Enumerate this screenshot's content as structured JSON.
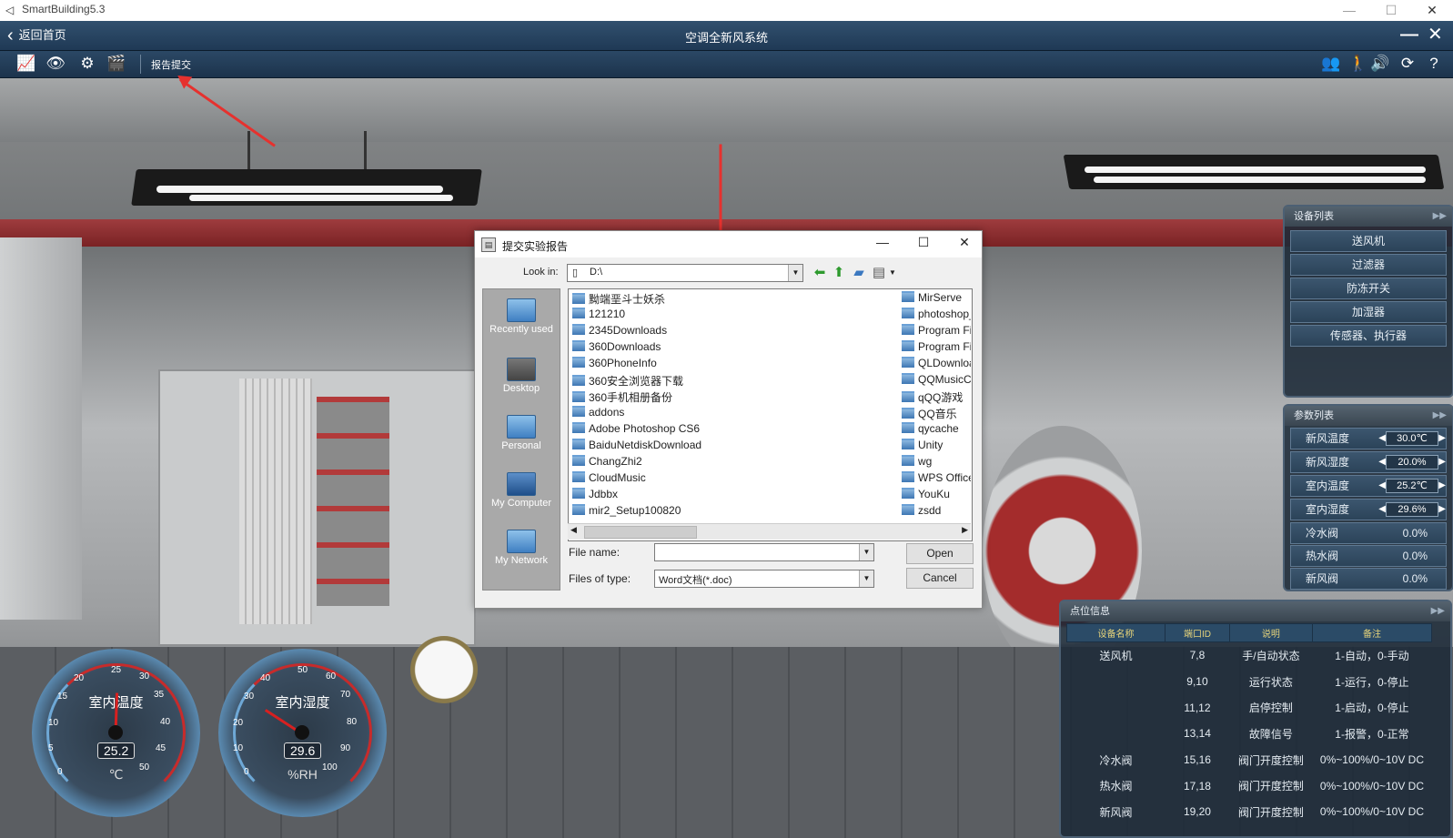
{
  "window": {
    "title": "SmartBuilding5.3",
    "minimize": "—",
    "maximize": "☐",
    "close": "✕"
  },
  "header": {
    "back_label": "返回首页",
    "title": "空调全新风系统",
    "minimize_symbol": "—",
    "close_symbol": "✕"
  },
  "toolbar": {
    "report_label": "报告提交",
    "left_icons": [
      "chart-icon",
      "eye-icon",
      "network-icon",
      "clapper-icon"
    ],
    "right_icons": [
      "users-icon",
      "walk-icon",
      "speaker-icon",
      "refresh-icon",
      "help-icon"
    ]
  },
  "dialog": {
    "title": "提交实验报告",
    "look_in_label": "Look in:",
    "look_in_value": "D:\\",
    "places": [
      {
        "label": "Recently used"
      },
      {
        "label": "Desktop"
      },
      {
        "label": "Personal"
      },
      {
        "label": "My Computer"
      },
      {
        "label": "My Network"
      }
    ],
    "files_col1": [
      "黝端垩斗士妖杀",
      "121210",
      "2345Downloads",
      "360Downloads",
      "360PhoneInfo",
      "360安全浏览器下载",
      "360手机相册备份",
      "addons",
      "Adobe Photoshop CS6",
      "BaiduNetdiskDownload",
      "ChangZhi2",
      "CloudMusic",
      "Jdbbx",
      "mir2_Setup100820"
    ],
    "files_col2": [
      "MirServe",
      "photoshop_c",
      "Program File",
      "Program File",
      "QLDownloa",
      "QQMusicCa",
      "qQQ游戏",
      "QQ音乐",
      "qycache",
      "Unity",
      "wg",
      "WPS Office",
      "YouKu",
      "zsdd"
    ],
    "file_name_label": "File name:",
    "file_name_value": "",
    "file_type_label": "Files of type:",
    "file_type_value": "Word文档(*.doc)",
    "open_label": "Open",
    "cancel_label": "Cancel"
  },
  "device_panel": {
    "title": "设备列表",
    "items": [
      "送风机",
      "过滤器",
      "防冻开关",
      "加湿器",
      "传感器、执行器"
    ]
  },
  "param_panel": {
    "title": "参数列表",
    "rows": [
      {
        "name": "新风温度",
        "value": "30.0℃",
        "adjustable": true
      },
      {
        "name": "新风湿度",
        "value": "20.0%",
        "adjustable": true
      },
      {
        "name": "室内温度",
        "value": "25.2℃",
        "adjustable": true
      },
      {
        "name": "室内湿度",
        "value": "29.6%",
        "adjustable": true
      },
      {
        "name": "冷水阀",
        "value": "0.0%",
        "adjustable": false
      },
      {
        "name": "热水阀",
        "value": "0.0%",
        "adjustable": false
      },
      {
        "name": "新风阀",
        "value": "0.0%",
        "adjustable": false
      }
    ]
  },
  "point_panel": {
    "title": "点位信息",
    "columns": [
      "设备名称",
      "端口ID",
      "说明",
      "备注"
    ],
    "rows": [
      [
        "送风机",
        "7,8",
        "手/自动状态",
        "1-自动，0-手动"
      ],
      [
        "",
        "9,10",
        "运行状态",
        "1-运行，0-停止"
      ],
      [
        "",
        "11,12",
        "启停控制",
        "1-启动，0-停止"
      ],
      [
        "",
        "13,14",
        "故障信号",
        "1-报警，0-正常"
      ],
      [
        "冷水阀",
        "15,16",
        "阀门开度控制",
        "0%~100%/0~10V DC"
      ],
      [
        "热水阀",
        "17,18",
        "阀门开度控制",
        "0%~100%/0~10V DC"
      ],
      [
        "新风阀",
        "19,20",
        "阀门开度控制",
        "0%~100%/0~10V DC"
      ]
    ]
  },
  "gauges": {
    "temperature": {
      "label": "室内温度",
      "value": "25.2",
      "unit": "℃",
      "ticks": [
        "0",
        "5",
        "10",
        "15",
        "20",
        "25",
        "30",
        "35",
        "40",
        "45",
        "50"
      ]
    },
    "humidity": {
      "label": "室内湿度",
      "value": "29.6",
      "unit": "%RH",
      "ticks": [
        "0",
        "10",
        "20",
        "30",
        "40",
        "50",
        "60",
        "70",
        "80",
        "90",
        "100"
      ]
    }
  },
  "colors": {
    "accent_red": "#e6312e",
    "header_blue": "#2a4866"
  }
}
